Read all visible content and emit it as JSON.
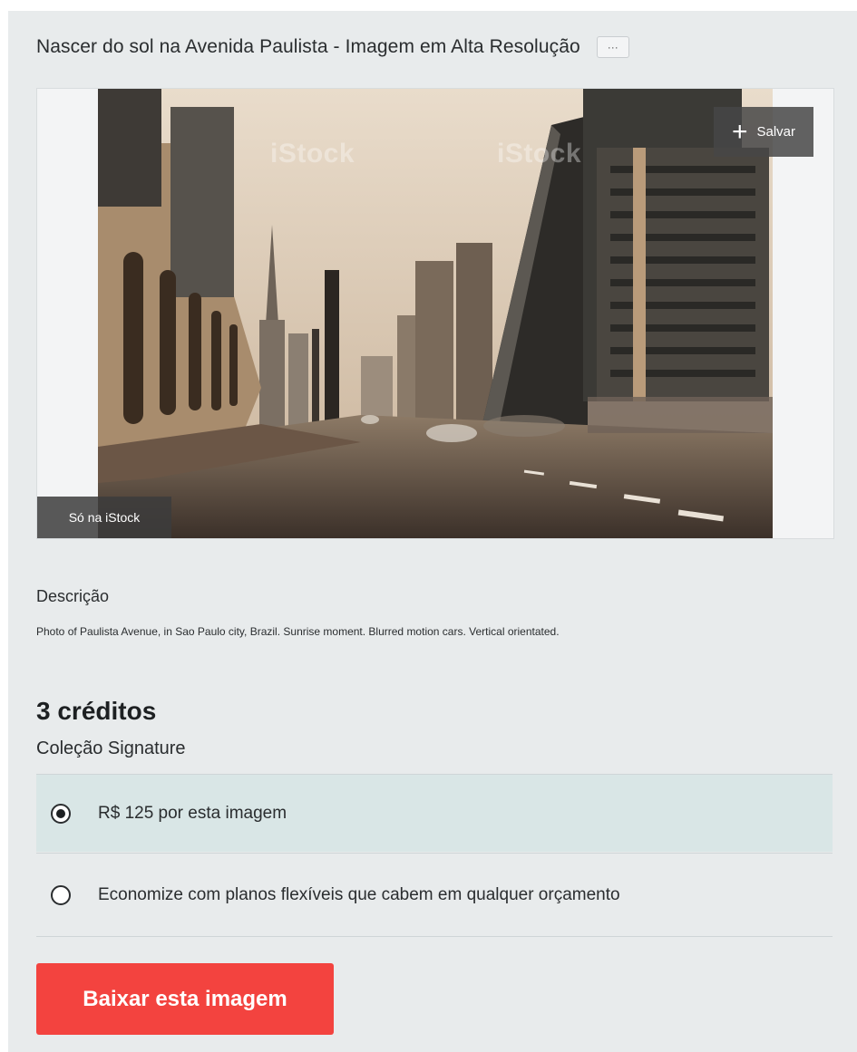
{
  "header": {
    "title": "Nascer do sol na Avenida Paulista - Imagem em Alta Resolução",
    "more_label": "···"
  },
  "image": {
    "save_label": "Salvar",
    "only_badge": "Só na iStock",
    "watermark": "iStock"
  },
  "description": {
    "label": "Descrição",
    "text": "Photo of Paulista Avenue, in Sao Paulo city, Brazil. Sunrise moment. Blurred motion cars. Vertical orientated."
  },
  "pricing": {
    "credits": "3 créditos",
    "collection": "Coleção Signature",
    "options": [
      {
        "label": "R$ 125 por esta imagem",
        "selected": true
      },
      {
        "label": "Economize com planos flexíveis que cabem em qualquer orçamento",
        "selected": false
      }
    ],
    "download_label": "Baixar esta imagem"
  },
  "colors": {
    "panel_bg": "#e8ebec",
    "selected_option_bg": "#d9e6e6",
    "download_button": "#f3433f"
  }
}
